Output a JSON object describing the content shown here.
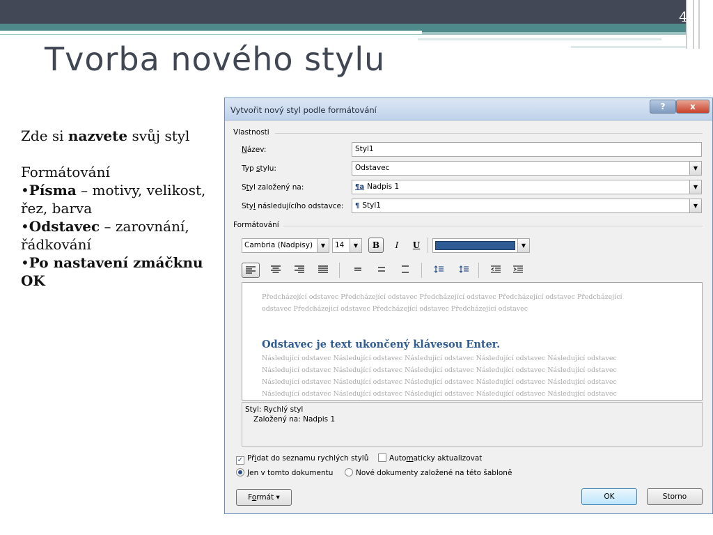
{
  "slide": {
    "page_number": "4",
    "title": "Tvorba nového stylu",
    "left_text": {
      "p1_a": "Zde si ",
      "p1_b": "nazvete",
      "p1_c": " svůj styl",
      "p2": "Formátování",
      "b1_dot": "•",
      "b1_bold": "Písma",
      "b1_rest": " – motivy, velikost, řez, barva",
      "b2_dot": "•",
      "b2_bold": "Odstavec",
      "b2_rest": " – zarovnání, řádkování",
      "b3_dot": "•",
      "b3_bold": "Po nastavení zmáčknu OK"
    }
  },
  "dialog": {
    "title": "Vytvořit nový styl podle formátování",
    "help_label": "?",
    "close_label": "x",
    "properties": {
      "group_label": "Vlastnosti",
      "name_label_u": "N",
      "name_label_rest": "ázev:",
      "name_value": "Styl1",
      "type_label_a": "Typ ",
      "type_label_u": "s",
      "type_label_b": "tylu:",
      "type_value": "Odstavec",
      "based_label_a": "S",
      "based_label_u": "t",
      "based_label_b": "yl založený na:",
      "based_icon": "¶a",
      "based_value": "Nadpis 1",
      "next_label_a": "Sty",
      "next_label_u": "l",
      "next_label_b": " následujícího odstavce:",
      "next_icon": "¶",
      "next_value": "Styl1"
    },
    "formatting": {
      "group_label": "Formátování",
      "font_value": "Cambria (Nadpisy)",
      "size_value": "14",
      "bold_label": "B",
      "italic_label": "I",
      "underline_label": "U",
      "font_color": "#2f5b95",
      "dropdown_arrow": "▼"
    },
    "preview": {
      "prev_line1": "Předcházející odstavec Předcházející odstavec Předcházející odstavec Předcházející odstavec Předcházející",
      "prev_line2": "odstavec Předcházející odstavec Předcházející odstavec Předcházející odstavec",
      "main_line": "Odstavec je text ukončený klávesou Enter.",
      "next_line1": "Následující odstavec Následující odstavec Následující odstavec Následující odstavec Následující odstavec",
      "next_line2": "Následující odstavec Následující odstavec Následující odstavec Následující odstavec Následující odstavec",
      "next_line3": "Následující odstavec Následující odstavec Následující odstavec Následující odstavec Následující odstavec",
      "next_line4": "Následující odstavec Následující odstavec Následující odstavec Následující odstavec Následující odstavec"
    },
    "description": {
      "line1": "Styl: Rychlý styl",
      "line2": "Založený na: Nadpis 1"
    },
    "options": {
      "add_quick_a": "Př",
      "add_quick_u": "i",
      "add_quick_b": "dat do seznamu rychlých stylů",
      "add_quick_checked": true,
      "auto_update_a": "Auto",
      "auto_update_u": "m",
      "auto_update_b": "aticky aktualizovat",
      "auto_update_checked": false,
      "only_doc_u": "J",
      "only_doc_b": "en v tomto dokumentu",
      "only_doc_selected": true,
      "new_docs": "Nové dokumenty založené na této šabloně",
      "new_docs_selected": false,
      "check_mark": "✓"
    },
    "buttons": {
      "format_a": "F",
      "format_u": "o",
      "format_b": "rmát ▾",
      "ok": "OK",
      "cancel": "Storno"
    }
  }
}
